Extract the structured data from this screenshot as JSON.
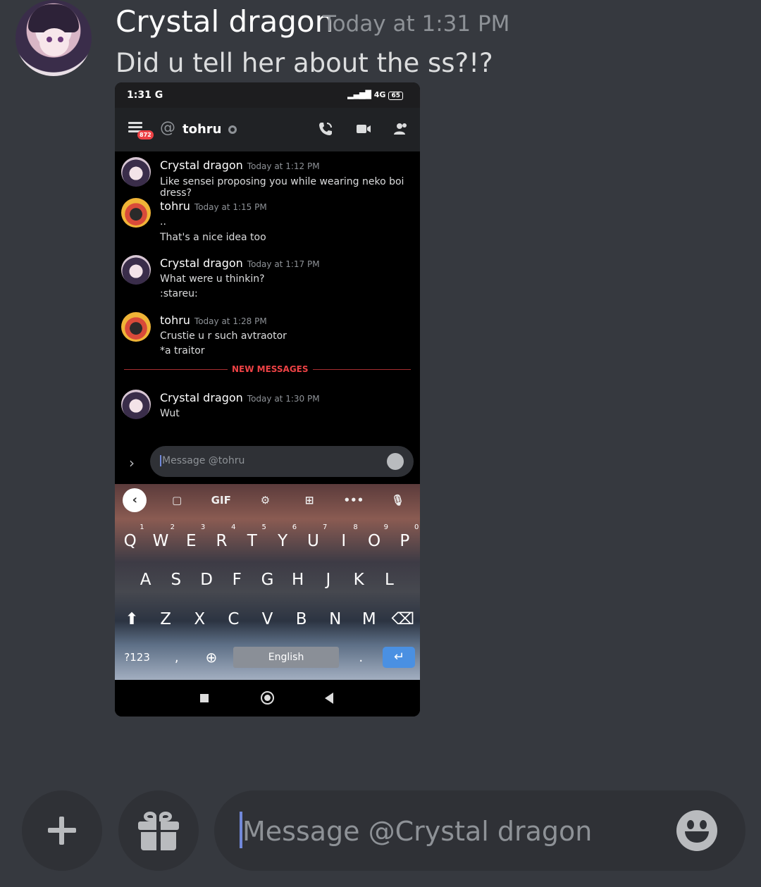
{
  "outer_message": {
    "author": "Crystal dragon",
    "timestamp": "Today at 1:31 PM",
    "text": "Did u tell her about the ss?!?"
  },
  "screenshot": {
    "statusbar": {
      "time": "1:31 G",
      "network": "4G",
      "battery": "65"
    },
    "header": {
      "channel": "tohru",
      "badge_count": "872"
    },
    "messages": [
      {
        "author": "Crystal dragon",
        "time": "Today at 1:12 PM",
        "lines": [
          "Like sensei proposing you while wearing neko boi dress?"
        ]
      },
      {
        "author": "tohru",
        "time": "Today at 1:15 PM",
        "lines": [
          "..",
          "That's a nice idea too"
        ]
      },
      {
        "author": "Crystal dragon",
        "time": "Today at 1:17 PM",
        "lines": [
          "What were u thinkin?",
          ":stareu:"
        ]
      },
      {
        "author": "tohru",
        "time": "Today at 1:28 PM",
        "lines": [
          "Crustie u r such avtraotor",
          "*a traitor"
        ]
      },
      {
        "author": "Crystal dragon",
        "time": "Today at 1:30 PM",
        "lines": [
          "Wut"
        ]
      }
    ],
    "new_messages_label": "NEW MESSAGES",
    "input_placeholder": "Message @tohru",
    "keyboard": {
      "toolbar": [
        "GIF"
      ],
      "row1": [
        "Q",
        "W",
        "E",
        "R",
        "T",
        "Y",
        "U",
        "I",
        "O",
        "P"
      ],
      "row1_hints": [
        "1",
        "2",
        "3",
        "4",
        "5",
        "6",
        "7",
        "8",
        "9",
        "0"
      ],
      "row2": [
        "A",
        "S",
        "D",
        "F",
        "G",
        "H",
        "J",
        "K",
        "L"
      ],
      "row3": [
        "Z",
        "X",
        "C",
        "V",
        "B",
        "N",
        "M"
      ],
      "symbols_key": "?123",
      "comma_key": ",",
      "period_key": ".",
      "space_label": "English"
    }
  },
  "composer": {
    "placeholder": "Message @Crystal dragon"
  },
  "colors": {
    "background": "#36393f",
    "input_bg": "#2f3136",
    "accent": "#7289da",
    "new_messages": "#ed4245"
  }
}
